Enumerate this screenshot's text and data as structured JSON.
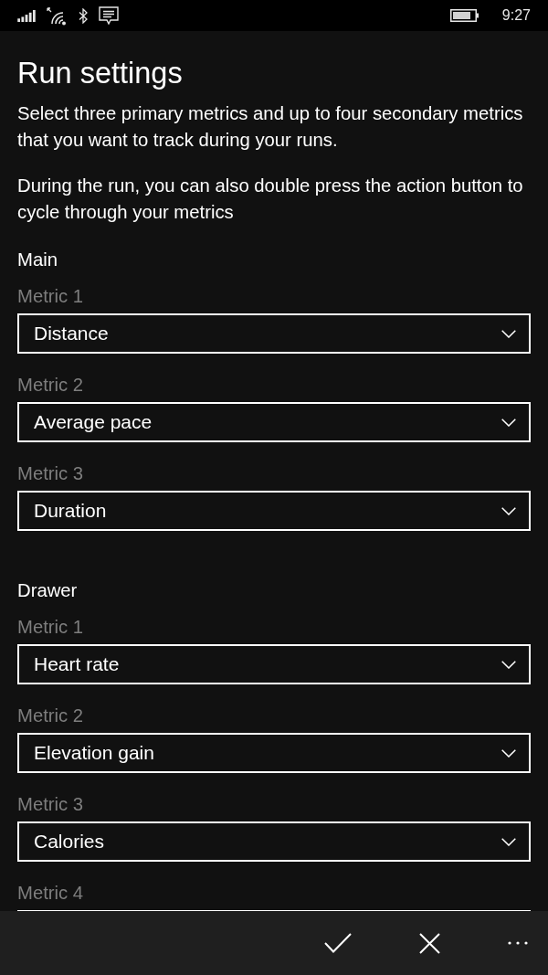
{
  "status_bar": {
    "time": "9:27"
  },
  "title": "Run settings",
  "intro": [
    "Select three primary metrics and up to four secondary metrics that you want to track during your runs.",
    "During the run, you can also double press the action button to cycle through your metrics"
  ],
  "sections": [
    {
      "heading": "Main",
      "metrics": [
        {
          "label": "Metric 1",
          "value": "Distance"
        },
        {
          "label": "Metric 2",
          "value": "Average pace"
        },
        {
          "label": "Metric 3",
          "value": "Duration"
        }
      ]
    },
    {
      "heading": "Drawer",
      "metrics": [
        {
          "label": "Metric 1",
          "value": "Heart rate"
        },
        {
          "label": "Metric 2",
          "value": "Elevation gain"
        },
        {
          "label": "Metric 3",
          "value": "Calories"
        },
        {
          "label": "Metric 4"
        }
      ]
    }
  ],
  "app_bar": {
    "buttons": [
      {
        "kind": "accept"
      },
      {
        "kind": "cancel"
      },
      {
        "kind": "more"
      }
    ]
  }
}
